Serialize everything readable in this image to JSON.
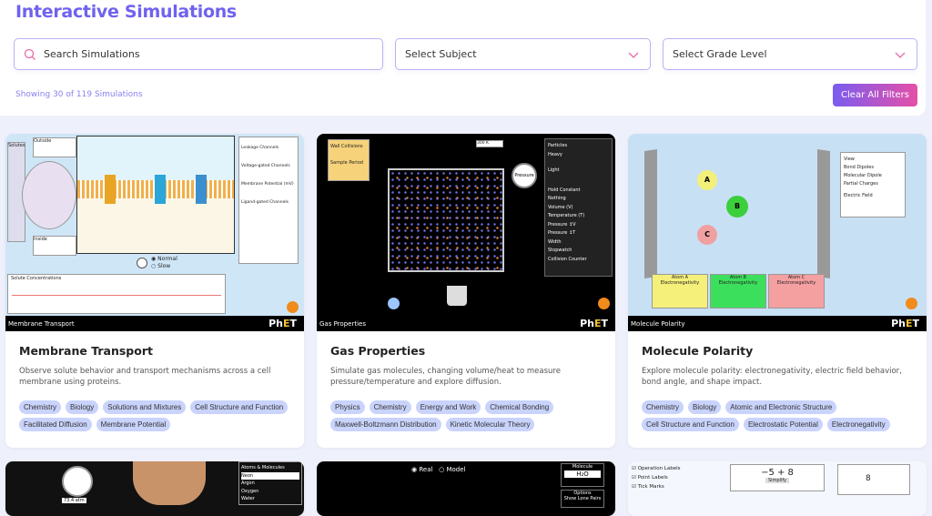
{
  "header": {
    "title": "Interactive Simulations",
    "search_placeholder": "Search Simulations",
    "subject_placeholder": "Select Subject",
    "grade_placeholder": "Select Grade Level",
    "showing": "Showing 30 of 119 Simulations",
    "clear_label": "Clear All Filters"
  },
  "colors": {
    "accent": "#6f62ee",
    "tag_bg": "#c9d3fb",
    "clear_gradient": [
      "#7a5cf0",
      "#e54fa7"
    ]
  },
  "cards": [
    {
      "title": "Membrane Transport",
      "description": "Observe solute behavior and transport mechanisms across a cell membrane using proteins.",
      "tags": [
        "Chemistry",
        "Biology",
        "Solutions and Mixtures",
        "Cell Structure and Function",
        "Facilitated Diffusion",
        "Membrane Potential"
      ],
      "sim_title": "Membrane Transport",
      "sim_labels": [
        "Solutes",
        "Outside",
        "Inside",
        "Leakage Channels",
        "Voltage-gated Channels",
        "Membrane Potential (mV)",
        "Ligand-gated Channels",
        "Solute Concentrations",
        "Normal",
        "Slow"
      ]
    },
    {
      "title": "Gas Properties",
      "description": "Simulate gas molecules, changing volume/heat to measure pressure/temperature and explore diffusion.",
      "tags": [
        "Physics",
        "Chemistry",
        "Energy and Work",
        "Chemical Bonding",
        "Maxwell-Boltzmann Distribution",
        "Kinetic Molecular Theory"
      ],
      "sim_title": "Gas Properties",
      "sim_labels": [
        "Wall Collisions",
        "Sample Period",
        "Particles",
        "Heavy",
        "Light",
        "Hold Constant",
        "Nothing",
        "Volume (V)",
        "Temperature (T)",
        "Pressure ↕V",
        "Pressure ↕T",
        "Width",
        "Stopwatch",
        "Collision Counter",
        "300 K",
        "Pressure"
      ]
    },
    {
      "title": "Molecule Polarity",
      "description": "Explore molecule polarity: electronegativity, electric field behavior, bond angle, and shape impact.",
      "tags": [
        "Chemistry",
        "Biology",
        "Atomic and Electronic Structure",
        "Cell Structure and Function",
        "Electrostatic Potential",
        "Electronegativity"
      ],
      "sim_title": "Molecule Polarity",
      "sim_labels": [
        "View",
        "Bond Dipoles",
        "Molecular Dipole",
        "Partial Charges",
        "Electric Field",
        "Atom A",
        "Atom B",
        "Atom C",
        "Electronegativity",
        "A",
        "B",
        "C"
      ]
    }
  ],
  "row2": {
    "card2_labels": [
      "Real",
      "Model",
      "Molecule",
      "H₂O",
      "Options",
      "Show Lone Pairs"
    ],
    "card3_labels": [
      "Operation Labels",
      "Point Labels",
      "Tick Marks",
      "−5 + 8",
      "8",
      "Simplify"
    ],
    "card1_labels": [
      "Atoms & Molecules",
      "Neon",
      "Argon",
      "Oxygen",
      "Water",
      "73.4 atm"
    ]
  },
  "logo": "PhET"
}
